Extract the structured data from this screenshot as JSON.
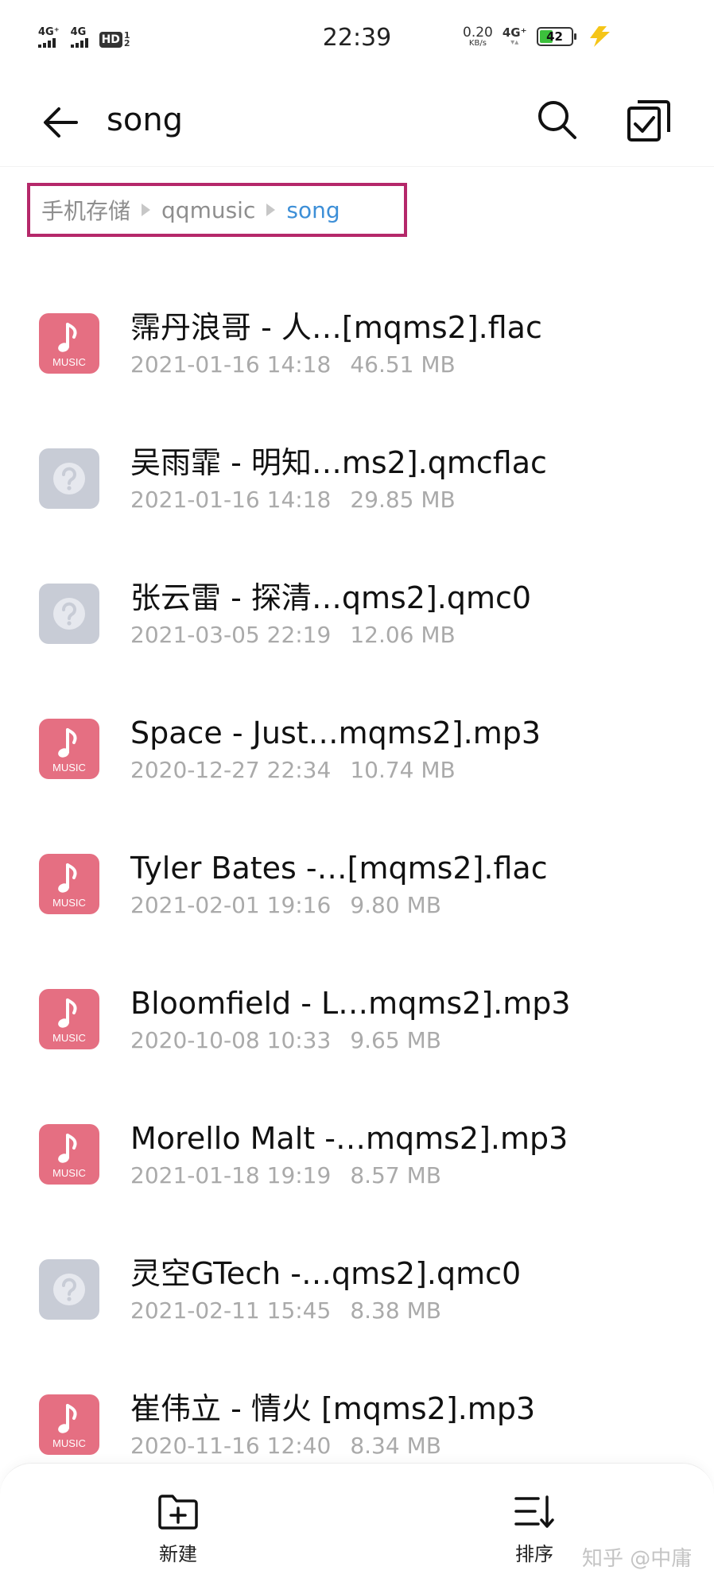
{
  "status_bar": {
    "signal1": "4G⁺",
    "signal2": "4G",
    "hd_label": "HD",
    "hd_sims": "1 2",
    "time": "22:39",
    "net_speed_value": "0.20",
    "net_speed_unit": "KB/s",
    "network_type": "4G⁺",
    "battery_level": "42",
    "battery_fill_fraction": 0.42,
    "battery_color": "#3cc13c",
    "charging_icon": "lightning-icon"
  },
  "header": {
    "title": "song",
    "back_icon": "back-arrow-icon",
    "search_icon": "search-icon",
    "select_icon": "checkbox-select-icon"
  },
  "breadcrumb": {
    "items": [
      "手机存储",
      "qqmusic",
      "song"
    ],
    "highlight_color": "#b5286a",
    "current_color": "#3d8fd7"
  },
  "files": [
    {
      "name": "霈丹浪哥 - 人…[mqms2].flac",
      "date": "2021-01-16 14:18",
      "size": "46.51 MB",
      "icon": "music"
    },
    {
      "name": "吴雨霏 - 明知…ms2].qmcflac",
      "date": "2021-01-16 14:18",
      "size": "29.85 MB",
      "icon": "unknown"
    },
    {
      "name": "张云雷 - 探清…qms2].qmc0",
      "date": "2021-03-05 22:19",
      "size": "12.06 MB",
      "icon": "unknown"
    },
    {
      "name": "Space - Just…mqms2].mp3",
      "date": "2020-12-27 22:34",
      "size": "10.74 MB",
      "icon": "music"
    },
    {
      "name": "Tyler Bates -…[mqms2].flac",
      "date": "2021-02-01 19:16",
      "size": "9.80 MB",
      "icon": "music"
    },
    {
      "name": "Bloomfield - L…mqms2].mp3",
      "date": "2020-10-08 10:33",
      "size": "9.65 MB",
      "icon": "music"
    },
    {
      "name": "Morello Malt -…mqms2].mp3",
      "date": "2021-01-18 19:19",
      "size": "8.57 MB",
      "icon": "music"
    },
    {
      "name": "灵空GTech -…qms2].qmc0",
      "date": "2021-02-11 15:45",
      "size": "8.38 MB",
      "icon": "unknown"
    },
    {
      "name": "崔伟立 - 情火 [mqms2].mp3",
      "date": "2020-11-16 12:40",
      "size": "8.34 MB",
      "icon": "music"
    }
  ],
  "icon_labels": {
    "music": "MUSIC",
    "music_color": "#e56f82",
    "unknown_color": "#c8ccd6"
  },
  "bottom_bar": {
    "new_label": "新建",
    "sort_label": "排序"
  },
  "watermark": "知乎 @中庸"
}
